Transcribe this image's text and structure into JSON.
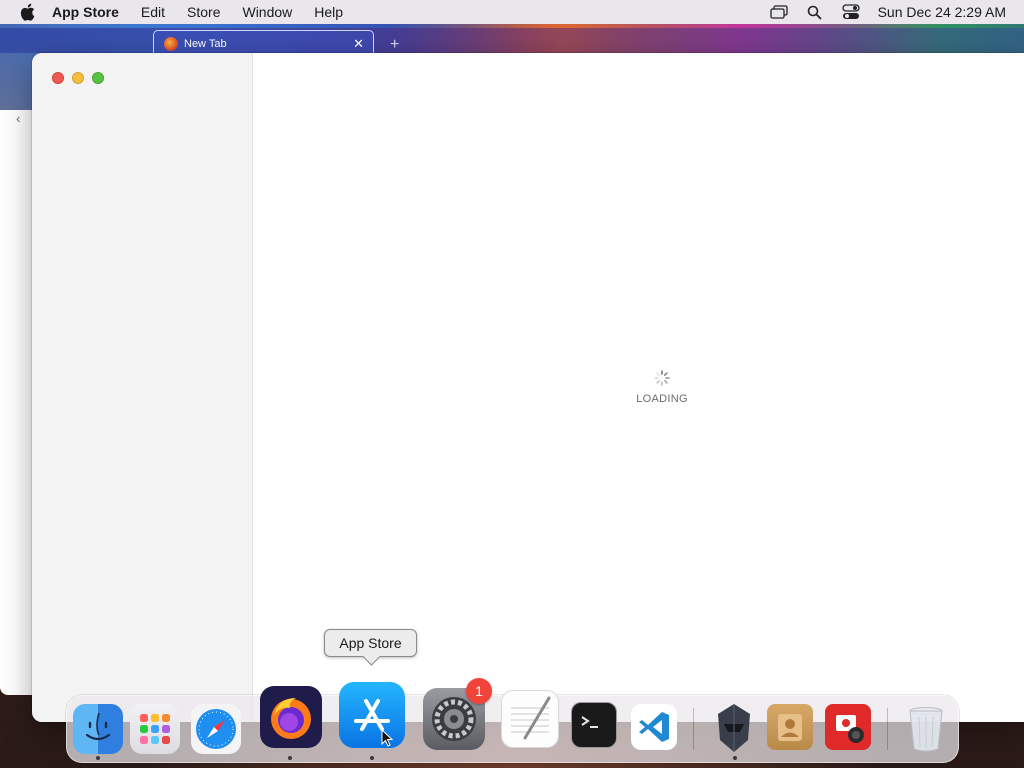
{
  "menubar": {
    "app_name": "App Store",
    "items": [
      "Edit",
      "Store",
      "Window",
      "Help"
    ],
    "clock": "Sun Dec 24  2:29 AM",
    "icons": [
      "apple-icon",
      "screen-mirroring-icon",
      "spotlight-search-icon",
      "control-center-icon"
    ]
  },
  "browser": {
    "tab_title": "New Tab",
    "tab_close": "✕",
    "new_tab": "+"
  },
  "app_window": {
    "loading_label": "LOADING"
  },
  "dock": {
    "tooltip": "App Store",
    "settings_badge": "1",
    "apps": [
      {
        "name": "Finder",
        "icon": "finder-icon",
        "running": true
      },
      {
        "name": "Launchpad",
        "icon": "launchpad-icon",
        "running": false
      },
      {
        "name": "Safari",
        "icon": "safari-icon",
        "running": false
      },
      {
        "name": "Firefox",
        "icon": "firefox-icon",
        "running": true
      },
      {
        "name": "App Store",
        "icon": "app-store-icon",
        "running": true
      },
      {
        "name": "System Preferences",
        "icon": "system-preferences-icon",
        "running": false
      },
      {
        "name": "TextEdit",
        "icon": "textedit-icon",
        "running": false
      },
      {
        "name": "Terminal",
        "icon": "terminal-icon",
        "running": false
      },
      {
        "name": "Visual Studio Code",
        "icon": "vscode-icon",
        "running": false
      },
      {
        "name": "Helmet App",
        "icon": "helmet-icon",
        "running": true
      },
      {
        "name": "Contacts",
        "icon": "contacts-icon",
        "running": false
      },
      {
        "name": "Photo Booth",
        "icon": "photo-booth-icon",
        "running": false
      },
      {
        "name": "Trash",
        "icon": "trash-icon",
        "running": false
      }
    ]
  },
  "colors": {
    "menubar_bg": "#e9e7ec",
    "sidebar_bg": "#f3f3f3",
    "close": "#ed5a53",
    "minimize": "#f4bd3e",
    "maximize": "#5ac243",
    "badge": "#f0443a"
  }
}
